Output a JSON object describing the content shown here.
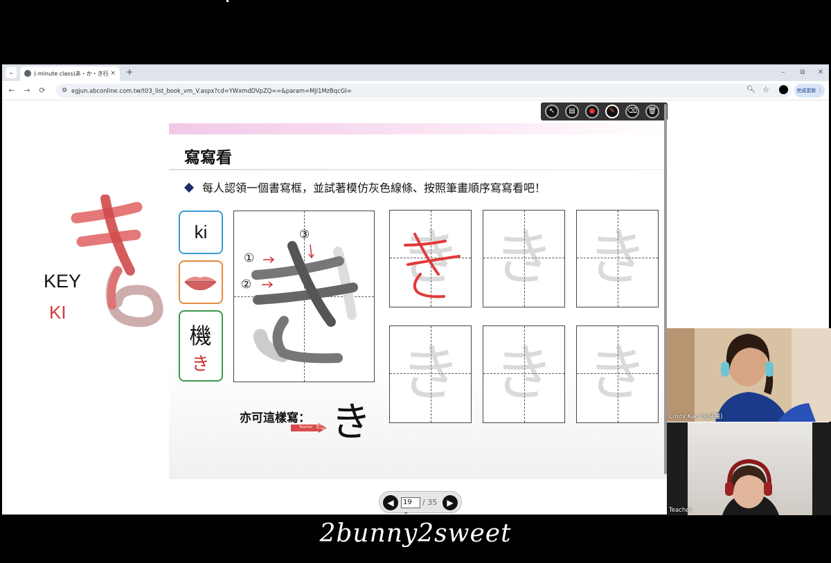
{
  "browser": {
    "tab_title": "(-minute class)あ・か・き行",
    "tab_close": "×",
    "new_tab": "+",
    "url": "egjun.abconline.com.tw/t03_list_book_vm_V.aspx?cd=YWxmdDVpZQ==&param=MjI1MzBqcGI=",
    "update_button": "完成更新 ⋮",
    "window_minimize": "–",
    "window_restore": "⧉",
    "window_close": "✕",
    "back": "←",
    "forward": "→",
    "reload": "⟳"
  },
  "annotation": {
    "key_label": "KEY",
    "ki_label": "KI"
  },
  "slide": {
    "title": "寫寫看",
    "instruction": "每人認領一個書寫框，並試著模仿灰色線條、按照筆畫順序寫寫看吧！",
    "romaji": "ki",
    "kanji": "機",
    "kanji_kana": "き",
    "ghost_kana": "き",
    "stroke_numbers": [
      "①",
      "②",
      "③"
    ],
    "alt_label": "亦可這樣寫：",
    "alt_kana": "き",
    "teacher_tag": "Teacher"
  },
  "pager": {
    "current": "19",
    "total": "/ 35",
    "prev": "◀",
    "next": "▶"
  },
  "videos": {
    "participant_name": "Cindy Kao (兔兒屬)",
    "teacher_name": "Teacher"
  },
  "watermark": "2bunny2sweet"
}
